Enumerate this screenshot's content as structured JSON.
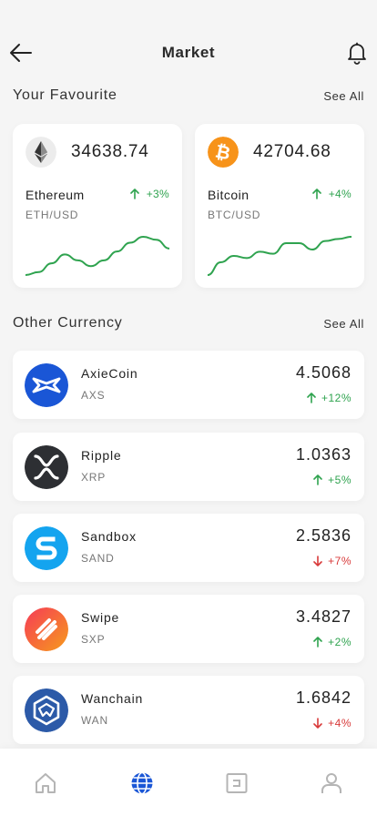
{
  "header": {
    "title": "Market",
    "back_icon": "arrow-left-icon",
    "bell_icon": "bell-icon"
  },
  "favourites": {
    "label": "Your Favourite",
    "see_all": "See All",
    "cards": [
      {
        "icon": "ethereum-icon",
        "price": "34638.74",
        "name": "Ethereum",
        "pair": "ETH/USD",
        "change": "+3%",
        "direction": "up",
        "color": "#2fa34f",
        "spark": [
          8,
          10,
          16,
          22,
          18,
          14,
          18,
          24,
          30,
          34,
          32,
          26
        ]
      },
      {
        "icon": "bitcoin-icon",
        "price": "42704.68",
        "name": "Bitcoin",
        "pair": "BTC/USD",
        "change": "+4%",
        "direction": "up",
        "color": "#2fa34f",
        "spark": [
          4,
          16,
          22,
          20,
          26,
          24,
          34,
          34,
          28,
          36,
          38,
          40
        ]
      }
    ]
  },
  "other": {
    "label": "Other Currency",
    "see_all": "See All",
    "coins": [
      {
        "name": "AxieCoin",
        "symbol": "AXS",
        "value": "4.5068",
        "change": "+12%",
        "direction": "up",
        "logo_color": "#1a56d6"
      },
      {
        "name": "Ripple",
        "symbol": "XRP",
        "value": "1.0363",
        "change": "+5%",
        "direction": "up",
        "logo_color": "#2d2f33"
      },
      {
        "name": "Sandbox",
        "symbol": "SAND",
        "value": "2.5836",
        "change": "+7%",
        "direction": "down",
        "logo_color": "#14a4ef"
      },
      {
        "name": "Swipe",
        "symbol": "SXP",
        "value": "3.4827",
        "change": "+2%",
        "direction": "up",
        "logo_color": "#f0562c"
      },
      {
        "name": "Wanchain",
        "symbol": "WAN",
        "value": "1.6842",
        "change": "+4%",
        "direction": "down",
        "logo_color": "#2c5aa8"
      }
    ]
  },
  "tabbar": {
    "tabs": [
      {
        "icon": "home-icon",
        "active": false
      },
      {
        "icon": "globe-icon",
        "active": true
      },
      {
        "icon": "wallet-icon",
        "active": false
      },
      {
        "icon": "profile-icon",
        "active": false
      }
    ],
    "active_color": "#1a56d6",
    "inactive_color": "#b5b5b5"
  }
}
